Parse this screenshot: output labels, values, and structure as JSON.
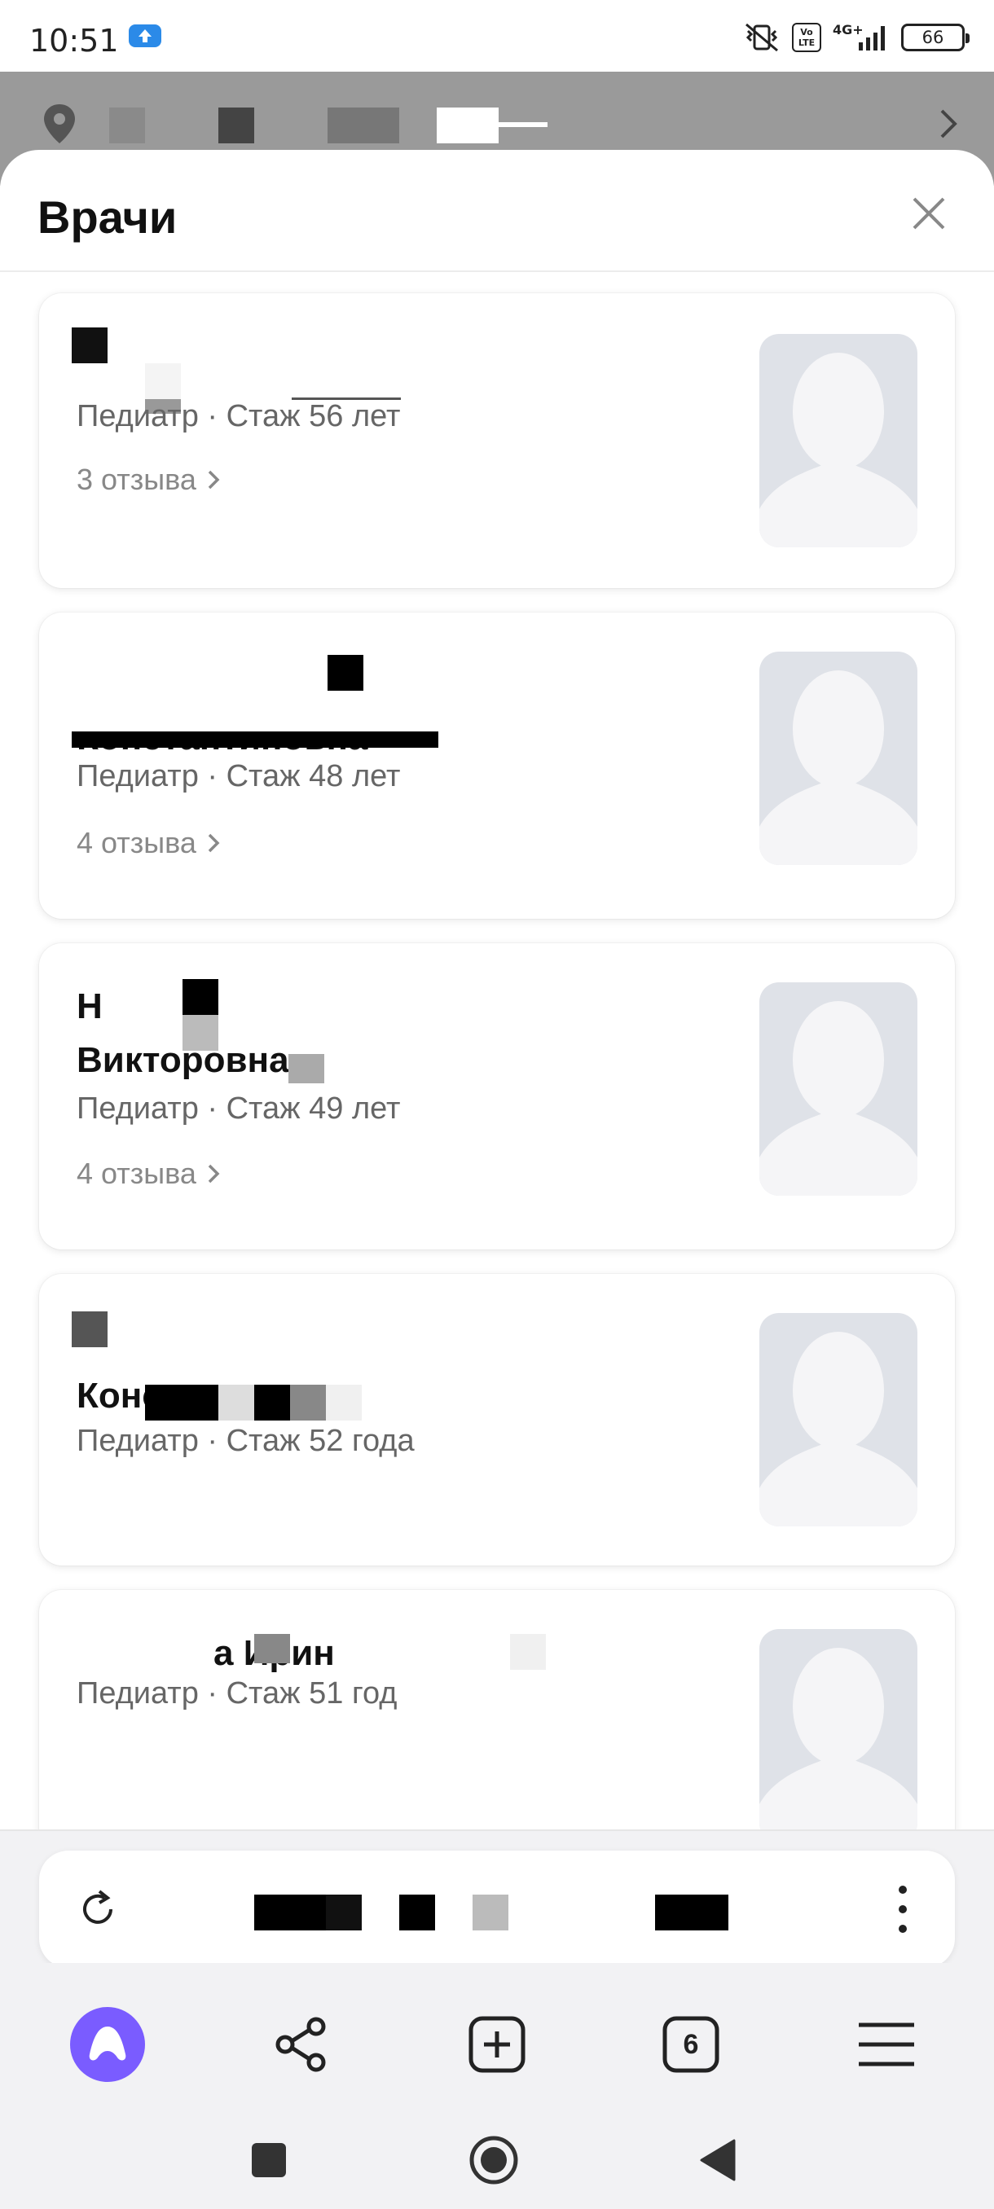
{
  "status_bar": {
    "time": "10:51",
    "network": "4G+",
    "battery": "66",
    "volte_top": "Vo",
    "volte_bottom": "LTE"
  },
  "sheet": {
    "title": "Врачи",
    "close_icon": "close-icon"
  },
  "doctors": [
    {
      "name_line1": "",
      "name_line2": "",
      "meta": "Педиатр · Стаж 56 лет",
      "reviews": "3 отзыва"
    },
    {
      "name_line1": "",
      "name_line2": "Константиновна",
      "meta": "Педиатр · Стаж 48 лет",
      "reviews": "4 отзыва"
    },
    {
      "name_line1": "Н",
      "name_line2": "Викторовна",
      "meta": "Педиатр · Стаж 49 лет",
      "reviews": "4 отзыва"
    },
    {
      "name_line1": "",
      "name_line2": "Конста",
      "meta": "Педиатр · Стаж 52 года",
      "reviews": ""
    },
    {
      "name_line1": "а Ирин",
      "name_line2": "",
      "meta": "Педиатр · Стаж 51 год",
      "reviews": ""
    }
  ],
  "toolbar": {
    "tabs_count": "6",
    "icons": [
      "alice-icon",
      "share-icon",
      "new-tab-icon",
      "tabs-icon",
      "menu-icon"
    ]
  },
  "navbar": {
    "icons": [
      "recents-icon",
      "home-icon",
      "back-icon"
    ]
  },
  "colors": {
    "accent": "#7a5cff",
    "avatar_bg": "#dfe2e8",
    "dim_header": "#9a9a9a"
  }
}
